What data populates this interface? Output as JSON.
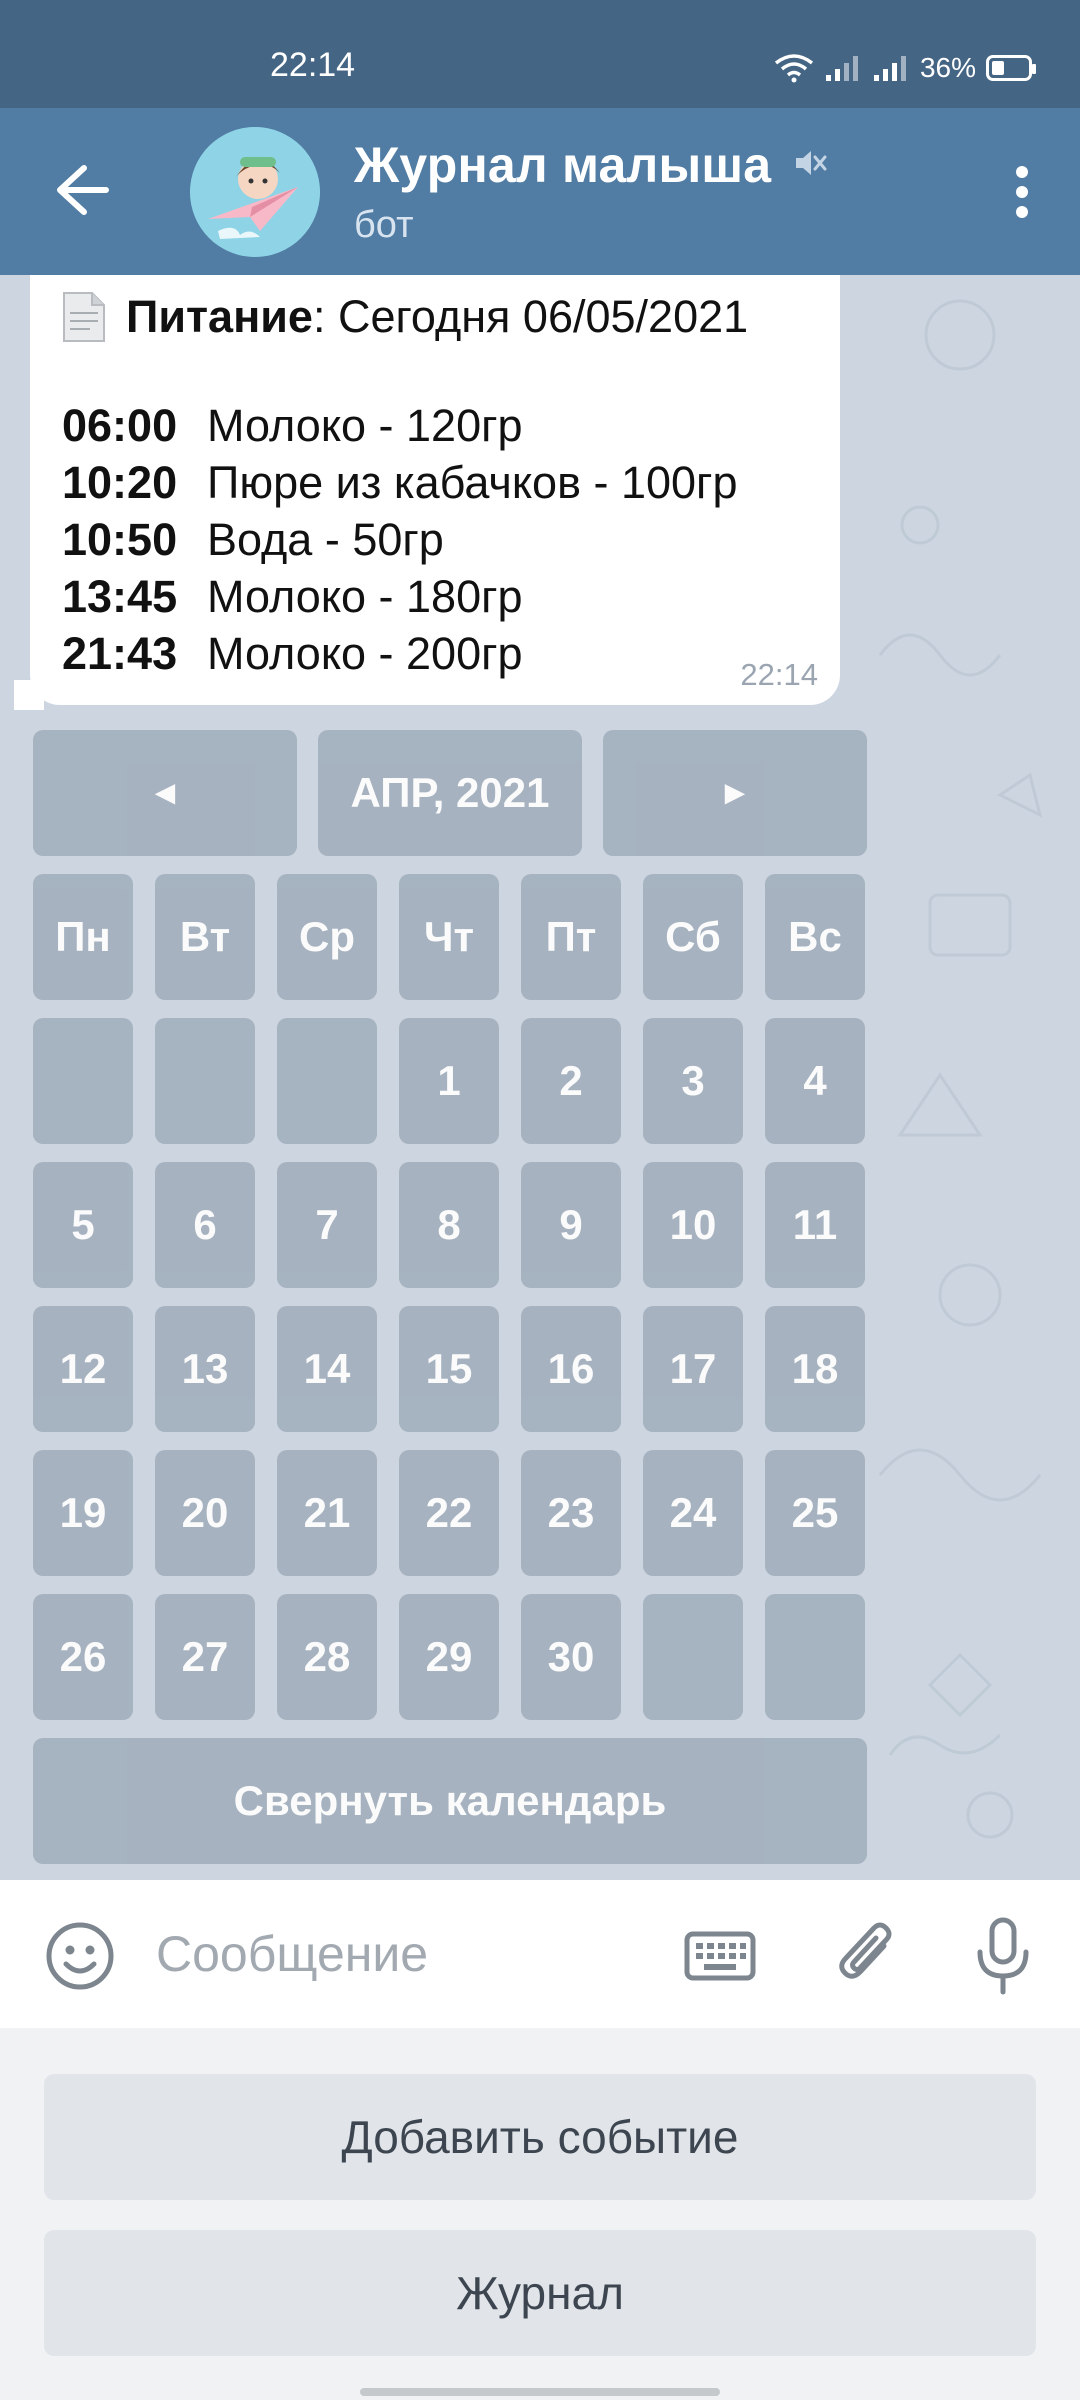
{
  "status_bar": {
    "time": "22:14",
    "battery": "36%"
  },
  "header": {
    "title": "Журнал малыша",
    "subtitle": "бот",
    "back_icon": "arrow-left-icon",
    "mute_icon": "muted-speaker-icon",
    "menu_icon": "vertical-dots-icon"
  },
  "message": {
    "doc_icon": "document-icon",
    "heading_bold": "Питание",
    "heading_rest": ": Сегодня 06/05/2021",
    "entries": [
      {
        "time": "06:00",
        "text": "Молоко - 120гр"
      },
      {
        "time": "10:20",
        "text": "Пюре из кабачков - 100гр"
      },
      {
        "time": "10:50",
        "text": "Вода - 50гр"
      },
      {
        "time": "13:45",
        "text": "Молоко - 180гр"
      },
      {
        "time": "21:43",
        "text": "Молоко - 200гр"
      }
    ],
    "sent_time": "22:14"
  },
  "calendar": {
    "prev": "◄",
    "month": "АПР, 2021",
    "next": "►",
    "weekdays": [
      "Пн",
      "Вт",
      "Ср",
      "Чт",
      "Пт",
      "Сб",
      "Вс"
    ],
    "weeks": [
      [
        "",
        "",
        "",
        "1",
        "2",
        "3",
        "4"
      ],
      [
        "5",
        "6",
        "7",
        "8",
        "9",
        "10",
        "11"
      ],
      [
        "12",
        "13",
        "14",
        "15",
        "16",
        "17",
        "18"
      ],
      [
        "19",
        "20",
        "21",
        "22",
        "23",
        "24",
        "25"
      ],
      [
        "26",
        "27",
        "28",
        "29",
        "30",
        "",
        ""
      ]
    ],
    "collapse": "Свернуть календарь"
  },
  "input": {
    "placeholder": "Сообщение",
    "emoji_icon": "smiley-icon",
    "keyboard_icon": "keyboard-icon",
    "attach_icon": "paperclip-icon",
    "mic_icon": "microphone-icon"
  },
  "reply_keyboard": {
    "buttons": [
      "Добавить событие",
      "Журнал"
    ]
  },
  "colors": {
    "header": "#517ca3",
    "status_bar": "#446584",
    "chat_bg": "#cdd6e0",
    "inline_button": "#a3b0bd"
  }
}
